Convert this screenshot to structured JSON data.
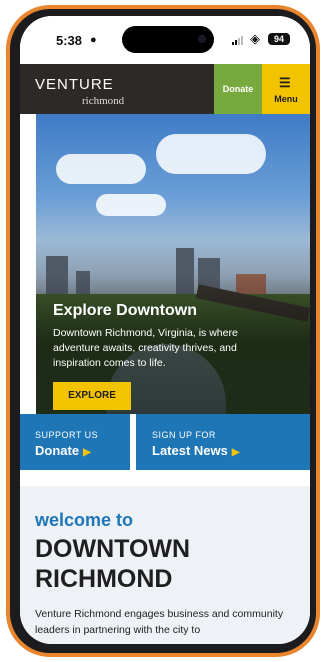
{
  "status_bar": {
    "time": "5:38",
    "battery": "94",
    "icons": [
      "person-icon",
      "signal-icon",
      "wifi-icon",
      "battery-icon"
    ]
  },
  "header": {
    "logo_main": "VENTURE",
    "logo_sub": "richmond",
    "donate_label": "Donate",
    "menu_label": "Menu",
    "colors": {
      "bar": "#2d2926",
      "donate": "#78a93e",
      "menu": "#f3c300"
    }
  },
  "hero": {
    "title": "Explore Downtown",
    "text": "Downtown Richmond, Virginia, is where adventure awaits, creativity thrives, and inspiration comes to life.",
    "button_label": "EXPLORE"
  },
  "cta": {
    "support_small": "SUPPORT US",
    "support_big": "Donate",
    "signup_small": "SIGN UP FOR",
    "signup_big": "Latest News",
    "color": "#1e76b6"
  },
  "welcome": {
    "small": "welcome to",
    "big": "DOWNTOWN RICHMOND",
    "body": "Venture Richmond engages business and community leaders in partnering with the city to"
  }
}
